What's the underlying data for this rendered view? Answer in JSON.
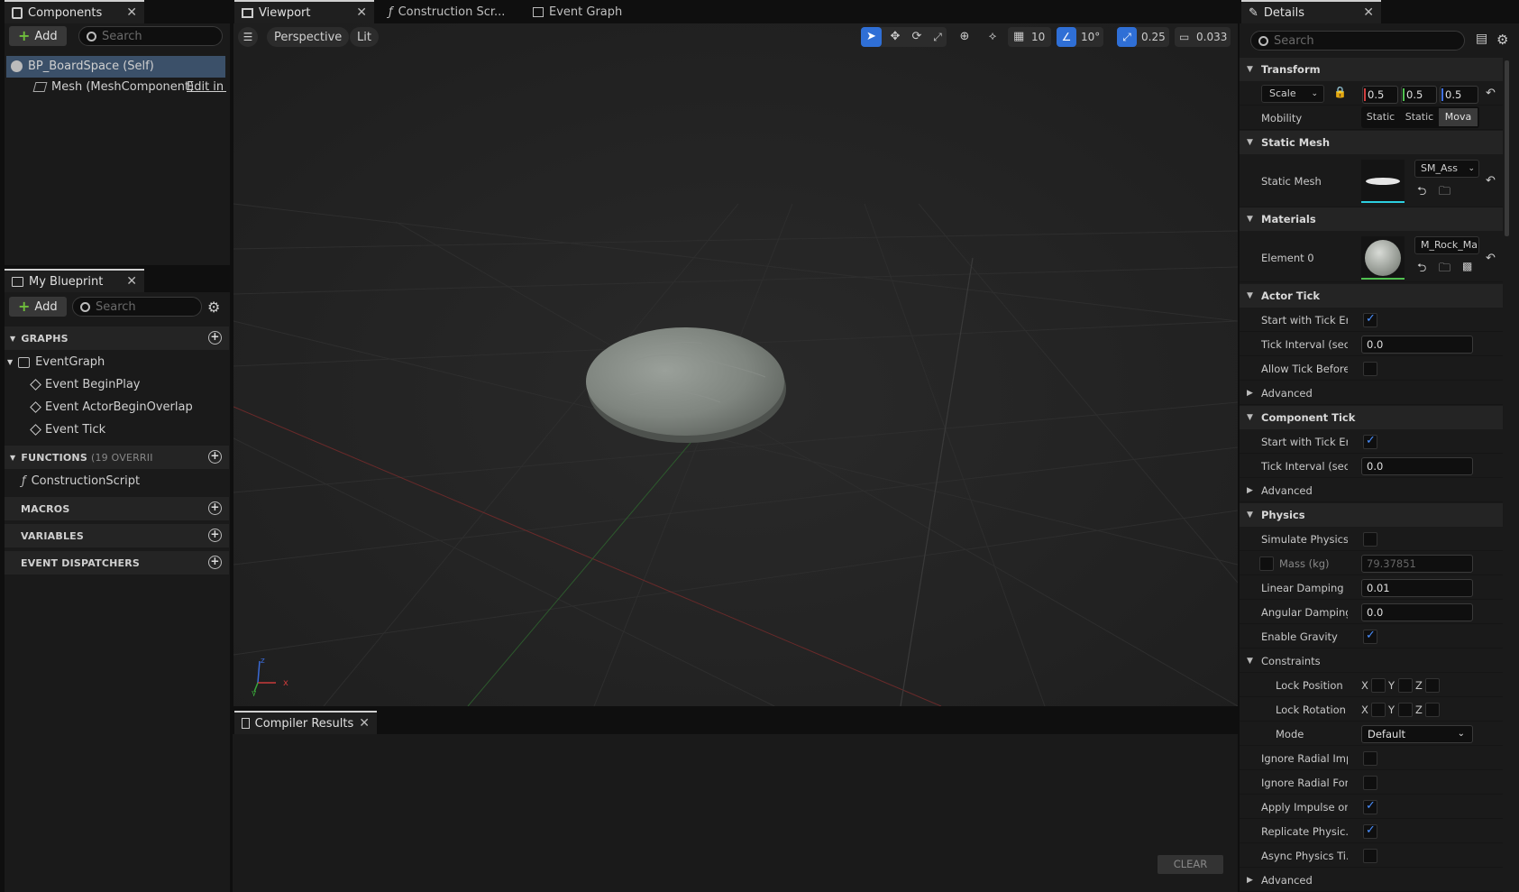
{
  "components": {
    "tab": "Components",
    "add": "Add",
    "search_placeholder": "Search",
    "items": [
      {
        "label": "BP_BoardSpace (Self)"
      },
      {
        "label": "Mesh (MeshComponent)",
        "extra": "Edit in C"
      }
    ]
  },
  "my_blueprint": {
    "tab": "My Blueprint",
    "add": "Add",
    "search_placeholder": "Search",
    "graphs_header": "GRAPHS",
    "event_graph": "EventGraph",
    "events": [
      "Event BeginPlay",
      "Event ActorBeginOverlap",
      "Event Tick"
    ],
    "functions_header": "FUNCTIONS",
    "functions_count": "(19 OVERRII",
    "construction_script": "ConstructionScript",
    "macros_header": "MACROS",
    "variables_header": "VARIABLES",
    "dispatchers_header": "EVENT DISPATCHERS"
  },
  "editor_tabs": [
    {
      "label": "Viewport",
      "active": true
    },
    {
      "label": "Construction Scr...",
      "active": false
    },
    {
      "label": "Event Graph",
      "active": false
    }
  ],
  "viewport": {
    "view_mode": "Perspective",
    "lighting": "Lit",
    "grid_snap": "10",
    "rotation_snap": "10°",
    "scale_snap": "0.25",
    "camera_speed": "0.033"
  },
  "compiler": {
    "tab": "Compiler Results",
    "clear": "CLEAR"
  },
  "details": {
    "tab": "Details",
    "search_placeholder": "Search",
    "transform": {
      "header": "Transform",
      "scale_label": "Scale",
      "x": "0.5",
      "y": "0.5",
      "z": "0.5",
      "mobility_label": "Mobility",
      "mobility_options": [
        "Static",
        "Static",
        "Mova"
      ]
    },
    "static_mesh": {
      "header": "Static Mesh",
      "label": "Static Mesh",
      "value": "SM_Ass"
    },
    "materials": {
      "header": "Materials",
      "label": "Element 0",
      "value": "M_Rock_Marb"
    },
    "actor_tick": {
      "header": "Actor Tick",
      "start_label": "Start with Tick En...",
      "interval_label": "Tick Interval (sec...",
      "interval_value": "0.0",
      "allow_label": "Allow Tick Before...",
      "advanced": "Advanced"
    },
    "component_tick": {
      "header": "Component Tick",
      "start_label": "Start with Tick En...",
      "interval_label": "Tick Interval (sec...",
      "interval_value": "0.0",
      "advanced": "Advanced"
    },
    "physics": {
      "header": "Physics",
      "simulate": "Simulate Physics",
      "mass_label": "Mass (kg)",
      "mass_value": "79.37851",
      "linear_label": "Linear Damping",
      "linear_value": "0.01",
      "angular_label": "Angular Damping",
      "angular_value": "0.0",
      "gravity_label": "Enable Gravity",
      "constraints": "Constraints",
      "lock_position": "Lock Position",
      "lock_rotation": "Lock Rotation",
      "axis_x": "X",
      "axis_y": "Y",
      "axis_z": "Z",
      "mode_label": "Mode",
      "mode_value": "Default",
      "ignore_radial_imp": "Ignore Radial Imp...",
      "ignore_radial_force": "Ignore Radial Force",
      "apply_impulse": "Apply Impulse on...",
      "replicate": "Replicate Physic...",
      "async": "Async Physics Ti...",
      "advanced": "Advanced"
    }
  },
  "colors": {
    "accent_blue": "#2f6fd6",
    "check_blue": "#4a8fff",
    "selection": "#3b5069",
    "add_green": "#6fbf3c"
  }
}
